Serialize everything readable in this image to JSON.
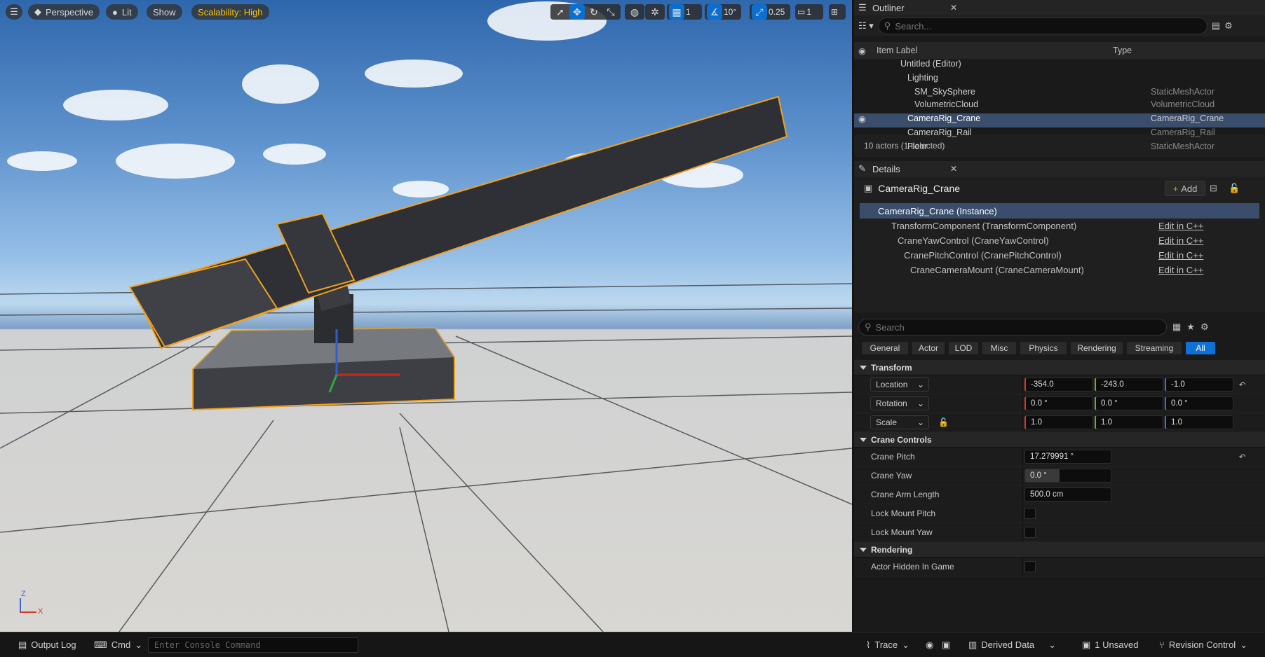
{
  "viewport": {
    "view_mode": "Perspective",
    "lighting": "Lit",
    "show": "Show",
    "scalability": "Scalability: High",
    "angle_snap": "10°",
    "scale_snap": "0.25",
    "grid_snap": "1",
    "camera_speed": "1",
    "axis_z": "Z",
    "axis_x": "X"
  },
  "outliner": {
    "tab": "Outliner",
    "search_placeholder": "Search...",
    "col_label": "Item Label",
    "col_type": "Type",
    "items": [
      {
        "label": "Untitled (Editor)",
        "type": ""
      },
      {
        "label": "Lighting",
        "type": ""
      },
      {
        "label": "SM_SkySphere",
        "type": "StaticMeshActor"
      },
      {
        "label": "VolumetricCloud",
        "type": "VolumetricCloud"
      },
      {
        "label": "CameraRig_Crane",
        "type": "CameraRig_Crane"
      },
      {
        "label": "CameraRig_Rail",
        "type": "CameraRig_Rail"
      },
      {
        "label": "Floor",
        "type": "StaticMeshActor"
      }
    ],
    "count": "10 actors (1 selected)"
  },
  "details": {
    "tab": "Details",
    "object": "CameraRig_Crane",
    "add": "Add",
    "components": [
      {
        "label": "CameraRig_Crane (Instance)",
        "edit": ""
      },
      {
        "label": "TransformComponent (TransformComponent)",
        "edit": "Edit in C++"
      },
      {
        "label": "CraneYawControl (CraneYawControl)",
        "edit": "Edit in C++"
      },
      {
        "label": "CranePitchControl (CranePitchControl)",
        "edit": "Edit in C++"
      },
      {
        "label": "CraneCameraMount (CraneCameraMount)",
        "edit": "Edit in C++"
      }
    ],
    "search_placeholder": "Search",
    "filters": [
      "General",
      "Actor",
      "LOD",
      "Misc",
      "Physics",
      "Rendering",
      "Streaming",
      "All"
    ],
    "transform": {
      "title": "Transform",
      "location": {
        "label": "Location",
        "x": "-354.0",
        "y": "-243.0",
        "z": "-1.0"
      },
      "rotation": {
        "label": "Rotation",
        "x": "0.0 °",
        "y": "0.0 °",
        "z": "0.0 °"
      },
      "scale": {
        "label": "Scale",
        "x": "1.0",
        "y": "1.0",
        "z": "1.0"
      }
    },
    "crane": {
      "title": "Crane Controls",
      "pitch_label": "Crane Pitch",
      "pitch": "17.279991 °",
      "yaw_label": "Crane Yaw",
      "yaw": "0.0 °",
      "arm_label": "Crane Arm Length",
      "arm": "500.0 cm",
      "lock_pitch": "Lock Mount Pitch",
      "lock_yaw": "Lock Mount Yaw"
    },
    "rendering": {
      "title": "Rendering",
      "hidden": "Actor Hidden In Game"
    }
  },
  "status": {
    "output_log": "Output Log",
    "cmd": "Cmd",
    "console_placeholder": "Enter Console Command",
    "trace": "Trace",
    "derived_data": "Derived Data",
    "unsaved": "1 Unsaved",
    "revision": "Revision Control"
  }
}
